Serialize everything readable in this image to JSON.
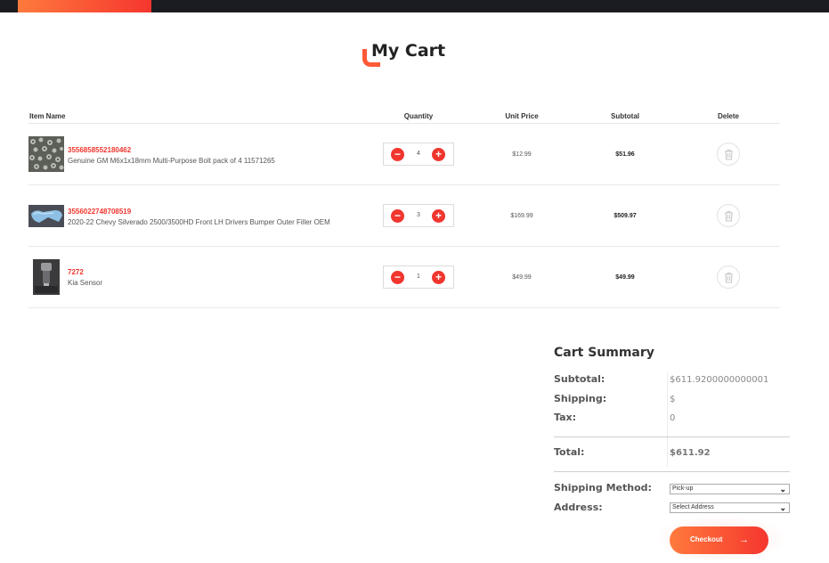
{
  "page": {
    "title": "My Cart"
  },
  "table": {
    "headers": {
      "item_name": "Item Name",
      "quantity": "Quantity",
      "unit_price": "Unit Price",
      "subtotal": "Subtotal",
      "delete": "Delete"
    },
    "items": [
      {
        "id": "3556858552180462",
        "name": "Genuine GM M6x1x18mm Multi-Purpose Bolt pack of 4 11571265",
        "quantity": "4",
        "unit_price": "$12.99",
        "subtotal": "$51.96",
        "thumbnail": "bolts-image"
      },
      {
        "id": "3556022748708519",
        "name": "2020-22 Chevy Silverado 2500/3500HD Front LH Drivers Bumper Outer Filler OEM",
        "quantity": "3",
        "unit_price": "$169.99",
        "subtotal": "$509.97",
        "thumbnail": "bumper-filler-image"
      },
      {
        "id": "7272",
        "name": "Kia Sensor",
        "quantity": "1",
        "unit_price": "$49.99",
        "subtotal": "$49.99",
        "thumbnail": "sensor-image"
      }
    ],
    "minus_symbol": "−",
    "plus_symbol": "+"
  },
  "summary": {
    "title": "Cart Summary",
    "subtotal_label": "Subtotal:",
    "subtotal_value": "$611.9200000000001",
    "shipping_label": "Shipping:",
    "shipping_value": "$",
    "tax_label": "Tax:",
    "tax_value": "0",
    "total_label": "Total:",
    "total_value": "$611.92",
    "shipping_method_label": "Shipping Method:",
    "shipping_method_value": "Pick-up",
    "address_label": "Address:",
    "address_value": "Select Address"
  },
  "checkout": {
    "label": "Checkout",
    "arrow": "→"
  },
  "colors": {
    "accent": "#f0362e",
    "accent_light": "#ff7a3d",
    "topbar": "#1b1c22"
  }
}
